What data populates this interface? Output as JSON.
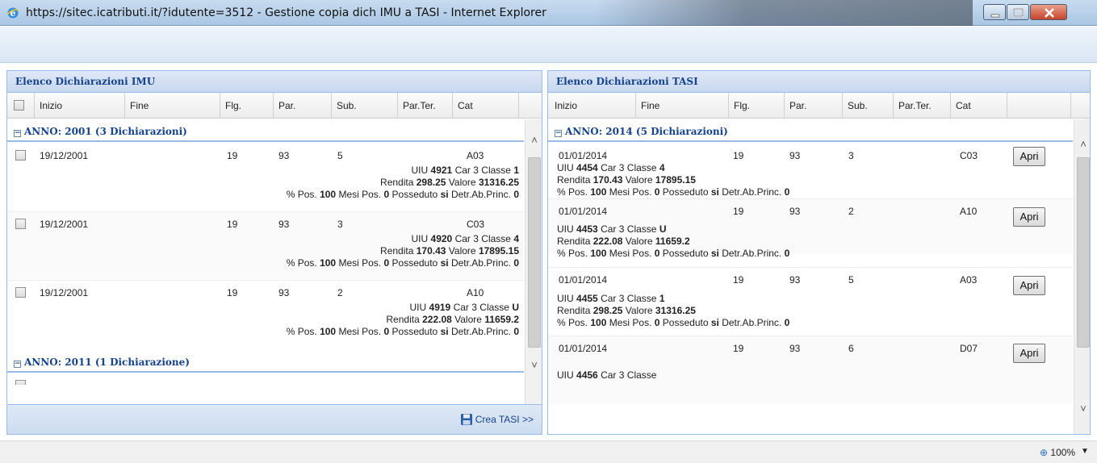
{
  "window": {
    "title": "https://sitec.icatributi.it/?idutente=3512 - Gestione copia dich IMU a TASI - Internet Explorer"
  },
  "imu": {
    "title": "Elenco Dichiarazioni IMU",
    "columns": [
      "Inizio",
      "Fine",
      "Flg.",
      "Par.",
      "Sub.",
      "Par.Ter.",
      "Cat"
    ],
    "groups": [
      {
        "label": "ANNO: 2001 (3 Dichiarazioni)",
        "rows": [
          {
            "inizio": "19/12/2001",
            "flg": "19",
            "par": "93",
            "sub": "5",
            "cat": "A03",
            "uiu": "4921",
            "car": "3",
            "classe": "1",
            "rendita": "298.25",
            "valore": "31316.25",
            "pos": "100",
            "mesi": "0",
            "posseduto": "si",
            "detr": "0"
          },
          {
            "inizio": "19/12/2001",
            "flg": "19",
            "par": "93",
            "sub": "3",
            "cat": "C03",
            "uiu": "4920",
            "car": "3",
            "classe": "4",
            "rendita": "170.43",
            "valore": "17895.15",
            "pos": "100",
            "mesi": "0",
            "posseduto": "si",
            "detr": "0"
          },
          {
            "inizio": "19/12/2001",
            "flg": "19",
            "par": "93",
            "sub": "2",
            "cat": "A10",
            "uiu": "4919",
            "car": "3",
            "classe": "U",
            "rendita": "222.08",
            "valore": "11659.2",
            "pos": "100",
            "mesi": "0",
            "posseduto": "si",
            "detr": "0"
          }
        ]
      },
      {
        "label": "ANNO: 2011 (1 Dichiarazione)",
        "rows": []
      }
    ],
    "crea_label": "Crea TASI >>"
  },
  "tasi": {
    "title": "Elenco Dichiarazioni TASI",
    "columns": [
      "Inizio",
      "Fine",
      "Flg.",
      "Par.",
      "Sub.",
      "Par.Ter.",
      "Cat"
    ],
    "group_label": "ANNO: 2014 (5 Dichiarazioni)",
    "apri_label": "Apri",
    "rows": [
      {
        "inizio": "01/01/2014",
        "flg": "19",
        "par": "93",
        "sub": "3",
        "cat": "C03",
        "uiu": "4454",
        "car": "3",
        "classe": "4",
        "rendita": "170.43",
        "valore": "17895.15",
        "pos": "100",
        "mesi": "0",
        "posseduto": "si",
        "detr": "0"
      },
      {
        "inizio": "01/01/2014",
        "flg": "19",
        "par": "93",
        "sub": "2",
        "cat": "A10",
        "uiu": "4453",
        "car": "3",
        "classe": "U",
        "rendita": "222.08",
        "valore": "11659.2",
        "pos": "100",
        "mesi": "0",
        "posseduto": "si",
        "detr": "0"
      },
      {
        "inizio": "01/01/2014",
        "flg": "19",
        "par": "93",
        "sub": "5",
        "cat": "A03",
        "uiu": "4455",
        "car": "3",
        "classe": "1",
        "rendita": "298.25",
        "valore": "31316.25",
        "pos": "100",
        "mesi": "0",
        "posseduto": "si",
        "detr": "0"
      },
      {
        "inizio": "01/01/2014",
        "flg": "19",
        "par": "93",
        "sub": "6",
        "cat": "D07",
        "uiu": "4456",
        "car": "3",
        "classe": ""
      }
    ]
  },
  "labels": {
    "uiu": "UIU",
    "car": "Car",
    "classe": "Classe",
    "rendita": "Rendita",
    "valore": "Valore",
    "pos": "% Pos.",
    "mesi": "Mesi Pos.",
    "posseduto": "Posseduto",
    "detr": "Detr.Ab.Princ."
  },
  "status": {
    "zoom": "100%"
  }
}
